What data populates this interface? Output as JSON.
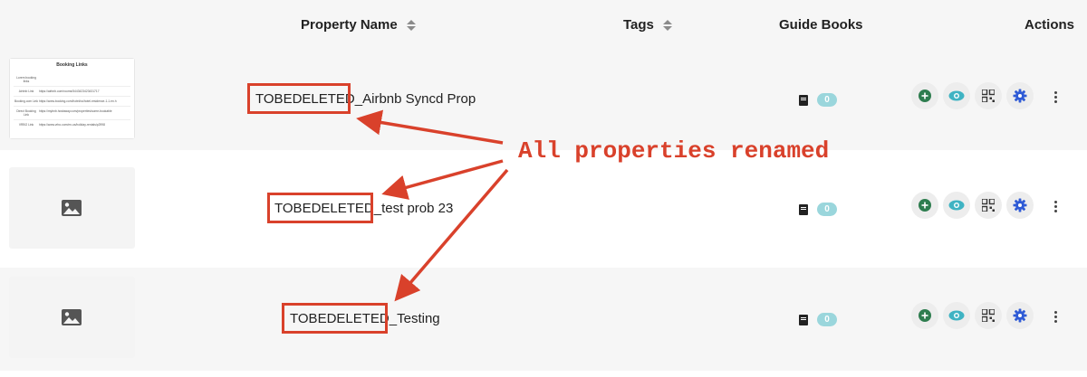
{
  "header": {
    "property_name": "Property Name",
    "tags": "Tags",
    "guide_books": "Guide Books",
    "actions": "Actions"
  },
  "booking_links": {
    "title": "Booking Links",
    "heading_row": "Lorem booking links",
    "rows": [
      {
        "k": "Airbnb Link",
        "v": "https://airbnb.com/rooms/5443423423431717"
      },
      {
        "k": "Booking.com Link",
        "v": "https://www.booking.com/hotel/us/hotel-residence-1-1.en.h"
      },
      {
        "k": "Direct Booking Link",
        "v": "https://mybnb.hostaway.com/properties/some-bookable"
      },
      {
        "k": "VRBO Link",
        "v": "https://www.vrbo.com/en-us/holiday-rentals/p2998"
      }
    ]
  },
  "rows": [
    {
      "prefix": "TOBEDELETED_",
      "rest": "Airbnb Syncd Prop",
      "guide_count": "0"
    },
    {
      "prefix": "TOBEDELETED_",
      "rest": "test prob 23",
      "guide_count": "0"
    },
    {
      "prefix": "TOBEDELETED_",
      "rest": "Testing",
      "guide_count": "0"
    }
  ],
  "annotation": "All properties renamed",
  "icons": {
    "add": "plus-circle-icon",
    "preview": "eye-icon",
    "qr": "qr-code-icon",
    "settings": "gear-icon",
    "more": "kebab-menu-icon",
    "guide": "book-icon",
    "placeholder": "image-placeholder-icon"
  },
  "colors": {
    "annotation_red": "#d9412b",
    "add_green": "#2e7d4f",
    "eye_teal": "#3fb3c3",
    "gear_blue": "#2f5bd6",
    "badge_teal": "#9ad6dc",
    "row_alt": "#f6f6f6"
  }
}
